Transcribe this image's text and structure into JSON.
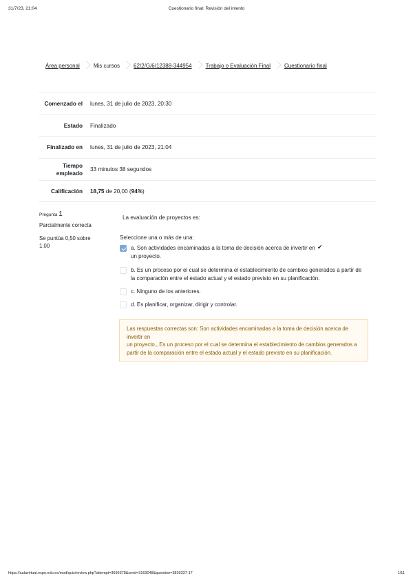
{
  "print": {
    "date": "31/7/23, 21:04",
    "title": "Cuestionario final: Revisión del intento",
    "url": "https://aulavirtual.espe.edu.ec/mod/quiz/review.php?attempt=3699378&cmid=3163048&question=3839337-17",
    "page": "1/11"
  },
  "breadcrumb": [
    "Área personal",
    "Mis cursos",
    "62/2/G/6/12388-344954",
    "Trabajo o Evaluación Final",
    "Cuestionario final"
  ],
  "summary": {
    "started_label": "Comenzado el",
    "started_value": "lunes, 31 de julio de 2023, 20:30",
    "state_label": "Estado",
    "state_value": "Finalizado",
    "finished_label": "Finalizado en",
    "finished_value": "lunes, 31 de julio de 2023, 21:04",
    "time_label_1": "Tiempo",
    "time_label_2": "empleado",
    "time_value": "33 minutos 38 segundos",
    "grade_label": "Calificación",
    "grade_score": "18,75",
    "grade_rest": " de 20,00 (",
    "grade_percent": "94%",
    "grade_close": ")"
  },
  "question": {
    "label": "Pregunta ",
    "number": "1",
    "state": "Parcialmente correcta",
    "grade_line1": "Se puntúa 0,50 sobre",
    "grade_line2": "1,00",
    "text": "La evaluación de proyectos es:",
    "prompt": "Seleccione una o más de una:",
    "answers": [
      {
        "line1": "a. Son actividades encaminadas a la toma de decisión acerca de invertir en",
        "line2": "un proyecto.",
        "checked": true,
        "correct_mark": "✔"
      },
      {
        "line1": "b. Es un proceso por el cual se determina el establecimiento de cambios generados a partir de",
        "line2": "la comparación entre el estado actual y el estado previsto en su planificación.",
        "checked": false
      },
      {
        "line1": "c. Ninguno de los anteriores.",
        "checked": false
      },
      {
        "line1": "d. Es planificar, organizar, dirigir y controlar.",
        "checked": false
      }
    ],
    "feedback": {
      "line1": "Las respuestas correctas son: Son actividades encaminadas a la toma de decisión acerca de",
      "line2": "invertir en",
      "line3": "un proyecto., Es un proceso por el cual se determina el establecimiento de cambios generados a",
      "line4": "partir de la comparación entre el estado actual y el estado previsto en su planificación."
    }
  }
}
